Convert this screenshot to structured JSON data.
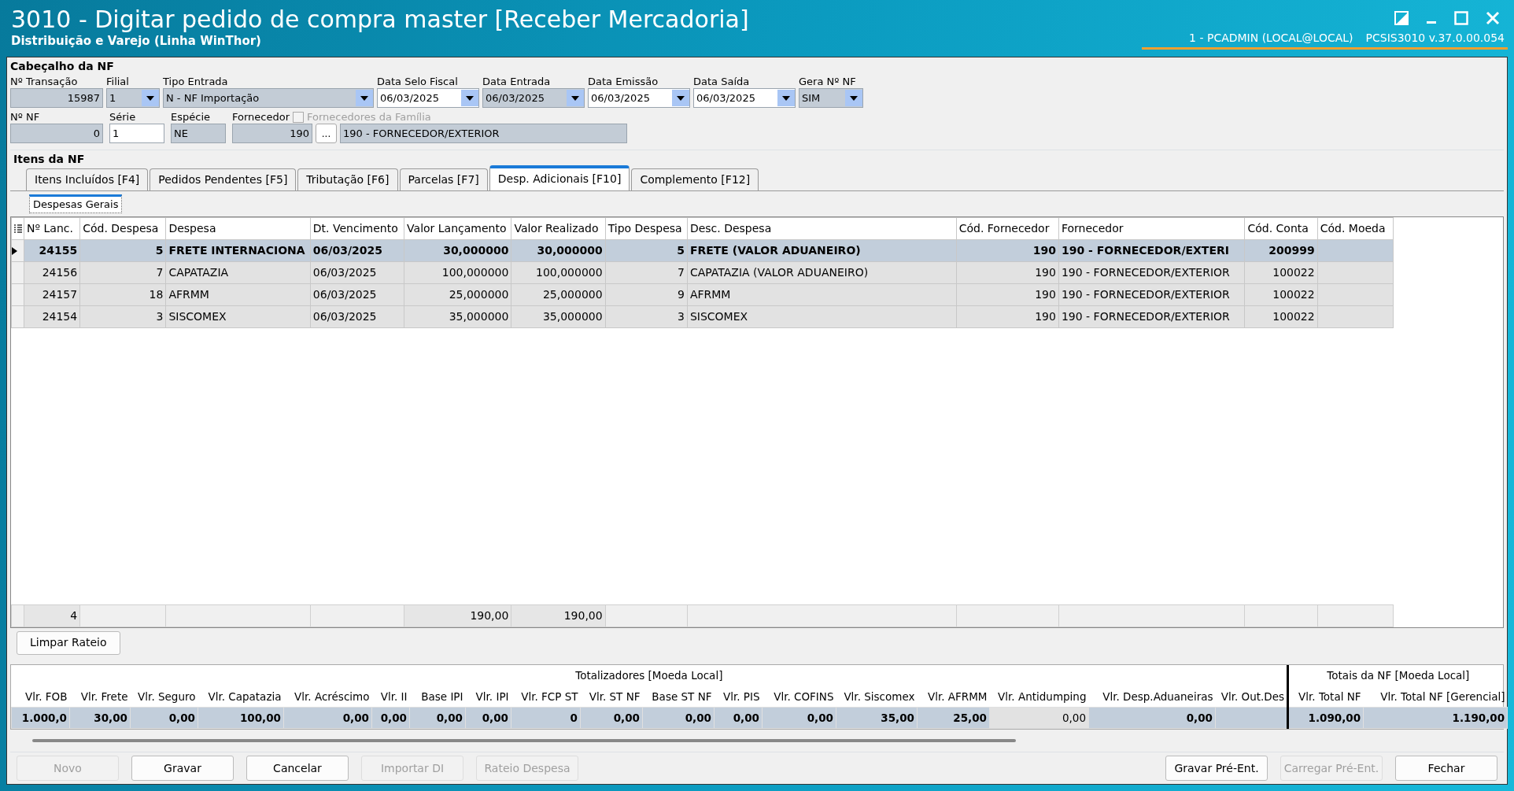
{
  "window": {
    "title": "3010 - Digitar pedido de compra master [Receber Mercadoria]",
    "subtitle": "Distribuição e Varejo (Linha WinThor)",
    "session": "1 - PCADMIN (LOCAL@LOCAL)",
    "program": "PCSIS3010  v.37.0.00.054"
  },
  "header": {
    "title": "Cabeçalho da NF",
    "row1": [
      {
        "label": "Nº Transação",
        "value": "15987",
        "kind": "text",
        "editable": false
      },
      {
        "label": "Filial",
        "value": "1",
        "kind": "combo",
        "editable": false
      },
      {
        "label": "Tipo Entrada",
        "value": "N - NF Importação",
        "kind": "combo",
        "editable": false
      },
      {
        "label": "Data Selo Fiscal",
        "value": "06/03/2025",
        "kind": "combo",
        "editable": true
      },
      {
        "label": "Data Entrada",
        "value": "06/03/2025",
        "kind": "combo",
        "editable": false
      },
      {
        "label": "Data Emissão",
        "value": "06/03/2025",
        "kind": "combo",
        "editable": true
      },
      {
        "label": "Data Saída",
        "value": "06/03/2025",
        "kind": "combo",
        "editable": true
      },
      {
        "label": "Gera Nº NF",
        "value": "SIM",
        "kind": "combo",
        "editable": false
      }
    ],
    "row2": [
      {
        "label": "Nº NF",
        "value": "0",
        "editable": false
      },
      {
        "label": "Série",
        "value": "1",
        "editable": true
      },
      {
        "label": "Espécie",
        "value": "NE",
        "editable": false
      },
      {
        "label": "Fornecedor",
        "value": "190",
        "editable": false
      }
    ],
    "lookup_button": "...",
    "family_checkbox": {
      "label": "Fornecedores da Família",
      "checked": false,
      "disabled": true
    },
    "supplier_name": "190 - FORNECEDOR/EXTERIOR"
  },
  "items_title": "Itens da NF",
  "tabs": [
    {
      "label": "Itens Incluídos [F4]",
      "selected": false
    },
    {
      "label": "Pedidos Pendentes [F5]",
      "selected": false
    },
    {
      "label": "Tributação [F6]",
      "selected": false
    },
    {
      "label": "Parcelas [F7]",
      "selected": false
    },
    {
      "label": "Desp. Adicionais [F10]",
      "selected": true
    },
    {
      "label": "Complemento [F12]",
      "selected": false
    }
  ],
  "subtabs": [
    {
      "label": "Despesas Gerais",
      "selected": true
    }
  ],
  "grid": {
    "columns": [
      "Nº Lanc.",
      "Cód. Despesa",
      "Despesa",
      "Dt. Vencimento",
      "Valor Lançamento",
      "Valor Realizado",
      "Tipo Despesa",
      "Desc. Despesa",
      "Cód. Fornecedor",
      "Fornecedor",
      "Cód. Conta",
      "Cód. Moeda"
    ],
    "rows": [
      {
        "selected": true,
        "cells": [
          "24155",
          "5",
          "FRETE INTERNACIONA",
          "06/03/2025",
          "30,000000",
          "30,000000",
          "5",
          "FRETE (VALOR ADUANEIRO)",
          "190",
          "190 - FORNECEDOR/EXTERI",
          "200999",
          null
        ]
      },
      {
        "selected": false,
        "cells": [
          "24156",
          "7",
          "CAPATAZIA",
          "06/03/2025",
          "100,000000",
          "100,000000",
          "7",
          "CAPATAZIA (VALOR ADUANEIRO)",
          "190",
          "190 - FORNECEDOR/EXTERIOR",
          "100022",
          null
        ]
      },
      {
        "selected": false,
        "cells": [
          "24157",
          "18",
          "AFRMM",
          "06/03/2025",
          "25,000000",
          "25,000000",
          "9",
          "AFRMM",
          "190",
          "190 - FORNECEDOR/EXTERIOR",
          "100022",
          null
        ]
      },
      {
        "selected": false,
        "cells": [
          "24154",
          "3",
          "SISCOMEX",
          "06/03/2025",
          "35,000000",
          "35,000000",
          "3",
          "SISCOMEX",
          "190",
          "190 - FORNECEDOR/EXTERIOR",
          "100022",
          null
        ]
      }
    ],
    "footer": {
      "count": "4",
      "valor_lancamento": "190,00",
      "valor_realizado": "190,00"
    }
  },
  "clear_button": "Limpar Rateio",
  "totals": {
    "group_local": "Totalizadores [Moeda Local]",
    "group_nf": "Totais da NF [Moeda Local]",
    "columns": [
      {
        "label": "Vlr. FOB",
        "value": "1.000,0",
        "bold": true
      },
      {
        "label": "Vlr. Frete",
        "value": "30,00",
        "bold": true
      },
      {
        "label": "Vlr. Seguro",
        "value": "0,00",
        "bold": true
      },
      {
        "label": "Vlr. Capatazia",
        "value": "100,00",
        "bold": true
      },
      {
        "label": "Vlr. Acréscimo",
        "value": "0,00",
        "bold": true
      },
      {
        "label": "Vlr. II",
        "value": "0,00",
        "bold": true
      },
      {
        "label": "Base IPI",
        "value": "0,00",
        "bold": true
      },
      {
        "label": "Vlr. IPI",
        "value": "0,00",
        "bold": true
      },
      {
        "label": "Vlr. FCP ST",
        "value": "0",
        "bold": true
      },
      {
        "label": "Vlr. ST NF",
        "value": "0,00",
        "bold": true
      },
      {
        "label": "Base ST NF",
        "value": "0,00",
        "bold": true
      },
      {
        "label": "Vlr. PIS",
        "value": "0,00",
        "bold": true
      },
      {
        "label": "Vlr. COFINS",
        "value": "0,00",
        "bold": true
      },
      {
        "label": "Vlr. Siscomex",
        "value": "35,00",
        "bold": true
      },
      {
        "label": "Vlr. AFRMM",
        "value": "25,00",
        "bold": true
      },
      {
        "label": "Vlr. Antidumping",
        "value": "0,00",
        "bold": false
      },
      {
        "label": "Vlr. Desp.Aduaneiras",
        "value": "0,00",
        "bold": true
      },
      {
        "label": "Vlr. Out.Des",
        "bold": true
      },
      {
        "label": "Vlr. Total NF",
        "value": "1.090,00",
        "bold": true
      },
      {
        "label": "Vlr. Total NF [Gerencial]",
        "value": "1.190,00",
        "bold": true
      }
    ]
  },
  "buttons_left": [
    {
      "label": "Novo",
      "disabled": true
    },
    {
      "label": "Gravar",
      "disabled": false
    },
    {
      "label": "Cancelar",
      "disabled": false
    },
    {
      "label": "Importar DI",
      "disabled": true
    },
    {
      "label": "Rateio Despesa",
      "disabled": true
    }
  ],
  "buttons_right": [
    {
      "label": "Gravar Pré-Ent.",
      "disabled": false
    },
    {
      "label": "Carregar Pré-Ent.",
      "disabled": true
    },
    {
      "label": "Fechar",
      "disabled": false
    }
  ]
}
